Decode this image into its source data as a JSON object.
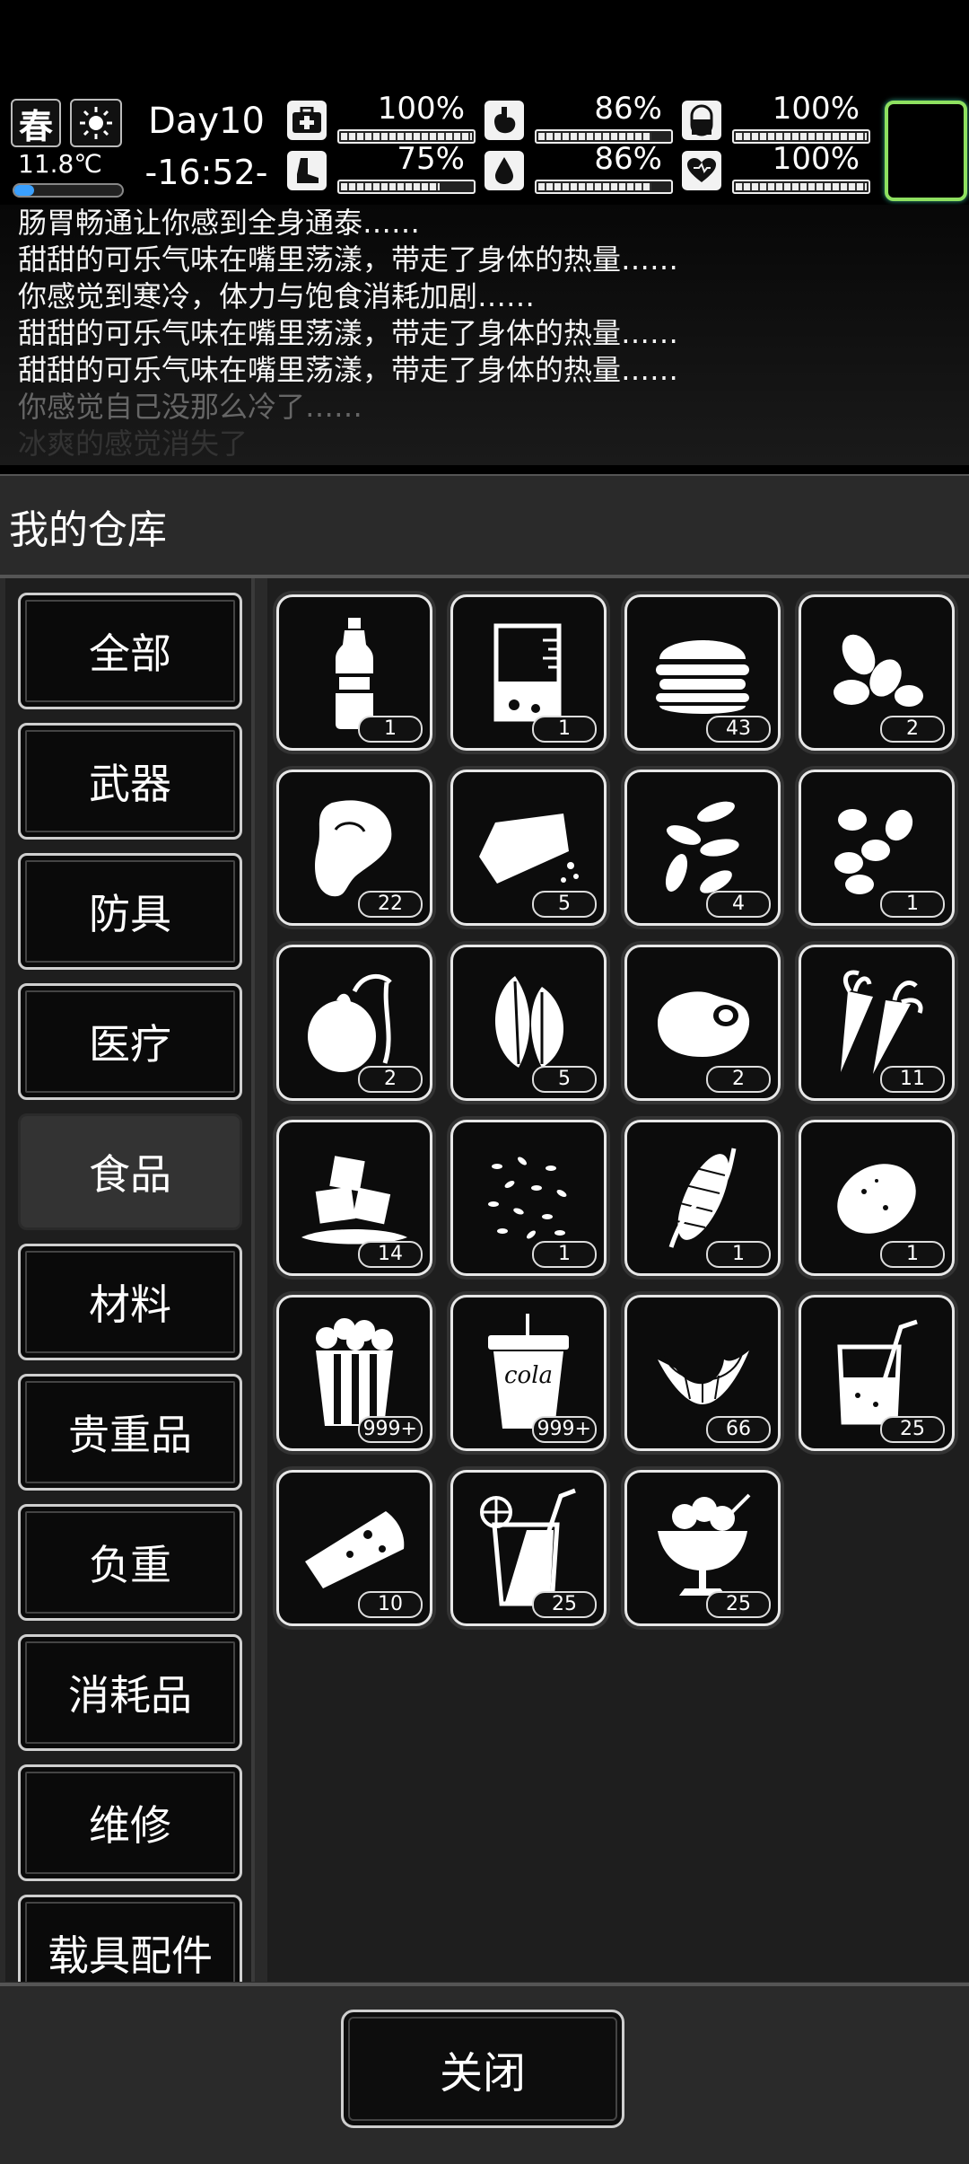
{
  "hud": {
    "season": "春",
    "temperature": "11.8℃",
    "temperature_level": 0.18,
    "day": "Day10",
    "clock": "-16:52-",
    "stats": [
      {
        "name": "health",
        "icon": "medkit-icon",
        "value": "100%",
        "level": 1.0
      },
      {
        "name": "stomach",
        "icon": "stomach-icon",
        "value": "86%",
        "level": 0.86
      },
      {
        "name": "pill",
        "icon": "pill-icon",
        "value": "100%",
        "level": 1.0
      },
      {
        "name": "stamina",
        "icon": "boot-icon",
        "value": "75%",
        "level": 0.75
      },
      {
        "name": "water",
        "icon": "water-drop-icon",
        "value": "86%",
        "level": 0.86
      },
      {
        "name": "mood",
        "icon": "heart-icon",
        "value": "100%",
        "level": 1.0
      }
    ]
  },
  "log": [
    "肠胃畅通让你感到全身通泰……",
    "甜甜的可乐气味在嘴里荡漾，带走了身体的热量……",
    "你感觉到寒冷，体力与饱食消耗加剧……",
    "甜甜的可乐气味在嘴里荡漾，带走了身体的热量……",
    "甜甜的可乐气味在嘴里荡漾，带走了身体的热量……",
    "你感觉自己没那么冷了……",
    "冰爽的感觉消失了"
  ],
  "panel": {
    "title": "我的仓库",
    "close_label": "关闭"
  },
  "categories": [
    "全部",
    "武器",
    "防具",
    "医疗",
    "食品",
    "材料",
    "贵重品",
    "负重",
    "消耗品",
    "维修",
    "载具配件"
  ],
  "active_category": 4,
  "items": [
    {
      "icon": "water-bottle-icon",
      "count": "1"
    },
    {
      "icon": "beaker-icon",
      "count": "1"
    },
    {
      "icon": "burger-icon",
      "count": "43"
    },
    {
      "icon": "nuts-icon",
      "count": "2"
    },
    {
      "icon": "meat-steak-icon",
      "count": "22"
    },
    {
      "icon": "bread-icon",
      "count": "5"
    },
    {
      "icon": "seeds-icon",
      "count": "4"
    },
    {
      "icon": "beans-icon",
      "count": "1"
    },
    {
      "icon": "sprouting-potato-icon",
      "count": "2"
    },
    {
      "icon": "leaves-icon",
      "count": "5"
    },
    {
      "icon": "raw-meat-icon",
      "count": "2"
    },
    {
      "icon": "carrot-icon",
      "count": "11"
    },
    {
      "icon": "ice-cubes-icon",
      "count": "14"
    },
    {
      "icon": "grains-icon",
      "count": "1"
    },
    {
      "icon": "corn-icon",
      "count": "1"
    },
    {
      "icon": "potato-icon",
      "count": "1"
    },
    {
      "icon": "popcorn-icon",
      "count": "999+"
    },
    {
      "icon": "cola-cup-icon",
      "count": "999+",
      "label": "cola"
    },
    {
      "icon": "croissant-icon",
      "count": "66"
    },
    {
      "icon": "juice-glass-icon",
      "count": "25"
    },
    {
      "icon": "pizza-slice-icon",
      "count": "10"
    },
    {
      "icon": "lemonade-icon",
      "count": "25"
    },
    {
      "icon": "ice-cream-sundae-icon",
      "count": "25"
    }
  ]
}
